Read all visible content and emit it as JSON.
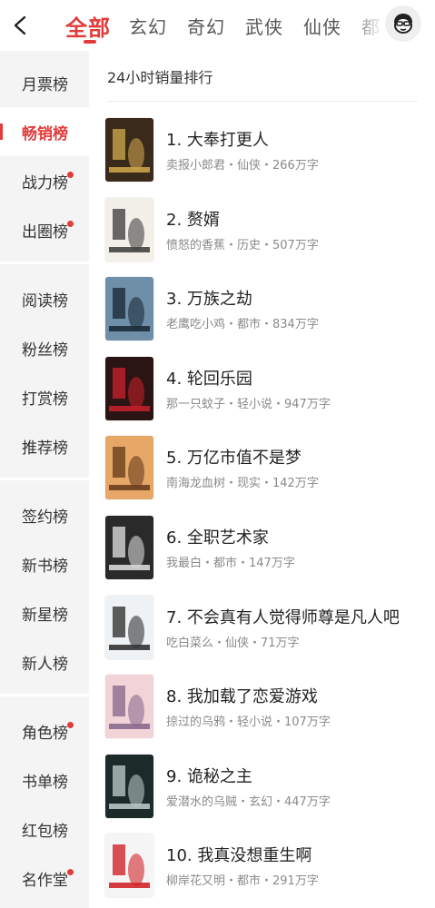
{
  "header": {
    "tabs": [
      "全部",
      "玄幻",
      "奇幻",
      "武侠",
      "仙侠",
      "都"
    ],
    "active_tab": "全部"
  },
  "sidebar": {
    "items": [
      {
        "label": "月票榜",
        "dot": false,
        "active": false
      },
      {
        "label": "畅销榜",
        "dot": false,
        "active": true
      },
      {
        "label": "战力榜",
        "dot": true,
        "active": false
      },
      {
        "label": "出圈榜",
        "dot": true,
        "active": false
      },
      {
        "label": "阅读榜",
        "dot": false,
        "active": false
      },
      {
        "label": "粉丝榜",
        "dot": false,
        "active": false
      },
      {
        "label": "打赏榜",
        "dot": false,
        "active": false
      },
      {
        "label": "推荐榜",
        "dot": false,
        "active": false
      },
      {
        "label": "签约榜",
        "dot": false,
        "active": false
      },
      {
        "label": "新书榜",
        "dot": false,
        "active": false
      },
      {
        "label": "新星榜",
        "dot": false,
        "active": false
      },
      {
        "label": "新人榜",
        "dot": false,
        "active": false
      },
      {
        "label": "角色榜",
        "dot": true,
        "active": false
      },
      {
        "label": "书单榜",
        "dot": false,
        "active": false
      },
      {
        "label": "红包榜",
        "dot": false,
        "active": false
      },
      {
        "label": "名作堂",
        "dot": true,
        "active": false
      }
    ]
  },
  "list": {
    "title": "24小时销量排行",
    "books": [
      {
        "title": "1. 大奉打更人",
        "meta": "卖报小郎君・仙侠・266万字",
        "cover_color": "#3a2a1c",
        "cover_accent": "#c9a24a"
      },
      {
        "title": "2. 赘婿",
        "meta": "愤怒的香蕉・历史・507万字",
        "cover_color": "#f3f0e8",
        "cover_accent": "#444444"
      },
      {
        "title": "3. 万族之劫",
        "meta": "老鹰吃小鸡・都市・834万字",
        "cover_color": "#6f8fa8",
        "cover_accent": "#1c2b3a"
      },
      {
        "title": "4. 轮回乐园",
        "meta": "那一只蚊子・轻小说・947万字",
        "cover_color": "#2b1414",
        "cover_accent": "#c2202a"
      },
      {
        "title": "5. 万亿市值不是梦",
        "meta": "南海龙血树・现实・142万字",
        "cover_color": "#e7a867",
        "cover_accent": "#6b3e1e"
      },
      {
        "title": "6. 全职艺术家",
        "meta": "我最白・都市・147万字",
        "cover_color": "#2a2a2a",
        "cover_accent": "#d8d8d8"
      },
      {
        "title": "7. 不会真有人觉得师尊是凡人吧",
        "meta": "吃白菜么・仙侠・71万字",
        "cover_color": "#eef2f5",
        "cover_accent": "#333333"
      },
      {
        "title": "8. 我加载了恋爱游戏",
        "meta": "掠过的乌鸦・轻小说・107万字",
        "cover_color": "#f2d4d8",
        "cover_accent": "#8a6a8e"
      },
      {
        "title": "9. 诡秘之主",
        "meta": "爱潜水的乌贼・玄幻・447万字",
        "cover_color": "#1d2a2a",
        "cover_accent": "#b8c4c4"
      },
      {
        "title": "10. 我真没想重生啊",
        "meta": "柳岸花又明・都市・291万字",
        "cover_color": "#f5f5f5",
        "cover_accent": "#d0262a"
      }
    ]
  }
}
